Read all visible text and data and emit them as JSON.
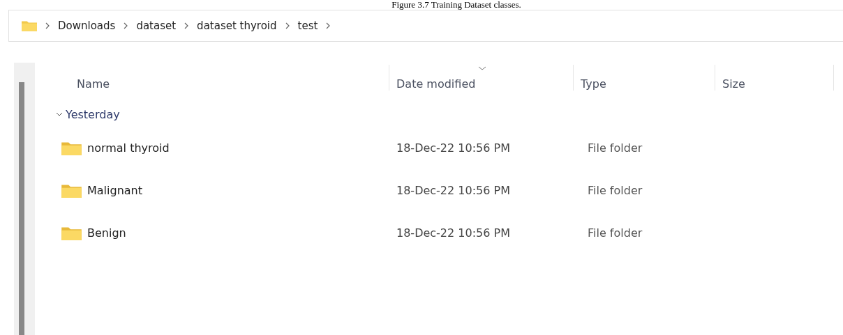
{
  "caption": "Figure 3.7 Training Dataset classes.",
  "breadcrumb": [
    "Downloads",
    "dataset",
    "dataset thyroid",
    "test"
  ],
  "columns": [
    {
      "label": "Name",
      "sorted": false
    },
    {
      "label": "Date modified",
      "sorted": true
    },
    {
      "label": "Type",
      "sorted": false
    },
    {
      "label": "Size",
      "sorted": false
    }
  ],
  "group": {
    "label": "Yesterday",
    "expanded": true
  },
  "rows": [
    {
      "name": "normal thyroid",
      "date": "18-Dec-22 10:56 PM",
      "type": "File folder"
    },
    {
      "name": "Malignant",
      "date": "18-Dec-22 10:56 PM",
      "type": "File folder"
    },
    {
      "name": "Benign",
      "date": "18-Dec-22 10:56 PM",
      "type": "File folder"
    }
  ]
}
